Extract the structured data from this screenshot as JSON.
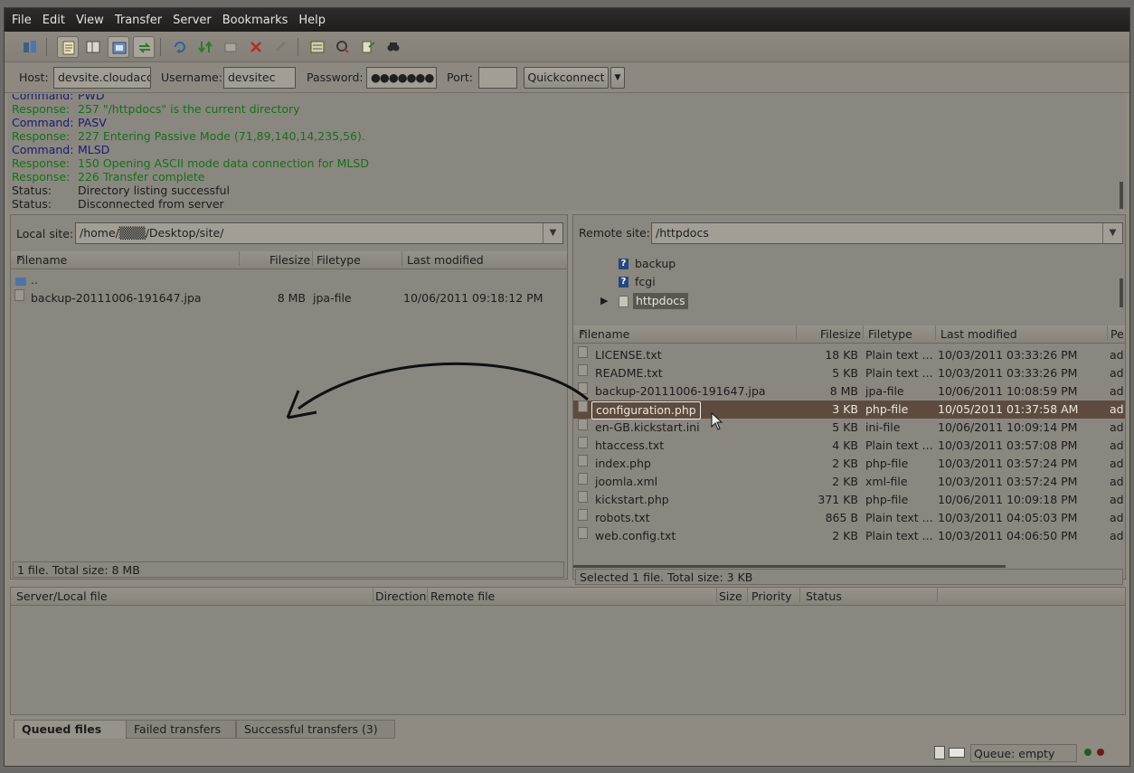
{
  "menu": [
    "File",
    "Edit",
    "View",
    "Transfer",
    "Server",
    "Bookmarks",
    "Help"
  ],
  "toolbar_icons": [
    "site-manager-icon",
    "toggle-log-icon",
    "toggle-local-tree-icon",
    "toggle-remote-tree-icon",
    "toggle-queue-icon",
    "refresh-icon",
    "process-queue-icon",
    "cancel-icon",
    "disconnect-icon",
    "reconnect-icon",
    "dir-compare-icon",
    "filter-icon",
    "sync-browse-icon",
    "search-icon"
  ],
  "quickconnect": {
    "host_label": "Host:",
    "host_value": "devsite.cloudacc",
    "username_label": "Username:",
    "username_value": "devsitec",
    "password_label": "Password:",
    "password_value": "●●●●●●●",
    "port_label": "Port:",
    "port_value": "",
    "button_label": "Quickconnect"
  },
  "log": [
    {
      "kind": "Command:",
      "text": "PWD",
      "type": "command"
    },
    {
      "kind": "Response:",
      "text": "257 \"/httpdocs\" is the current directory",
      "type": "response"
    },
    {
      "kind": "Command:",
      "text": "PASV",
      "type": "command"
    },
    {
      "kind": "Response:",
      "text": "227 Entering Passive Mode (71,89,140,14,235,56).",
      "type": "response"
    },
    {
      "kind": "Command:",
      "text": "MLSD",
      "type": "command"
    },
    {
      "kind": "Response:",
      "text": "150 Opening ASCII mode data connection for MLSD",
      "type": "response"
    },
    {
      "kind": "Response:",
      "text": "226 Transfer complete",
      "type": "response"
    },
    {
      "kind": "Status:",
      "text": "Directory listing successful",
      "type": "status"
    },
    {
      "kind": "Status:",
      "text": "Disconnected from server",
      "type": "status"
    }
  ],
  "local": {
    "label": "Local site:",
    "path": "/home/▒▒▒/Desktop/site/",
    "columns": [
      "Filename",
      "Filesize",
      "Filetype",
      "Last modified"
    ],
    "parent": "..",
    "files": [
      {
        "name": "backup-20111006-191647.jpa",
        "size": "8 MB",
        "type": "jpa-file",
        "modified": "10/06/2011 09:18:12 PM"
      }
    ],
    "status": "1 file. Total size: 8 MB"
  },
  "remote": {
    "label": "Remote site:",
    "path": "/httpdocs",
    "tree": [
      "backup",
      "fcgi",
      "httpdocs"
    ],
    "columns": [
      "Filename",
      "Filesize",
      "Filetype",
      "Last modified",
      "Pe"
    ],
    "files": [
      {
        "name": "LICENSE.txt",
        "size": "18 KB",
        "type": "Plain text ...",
        "modified": "10/03/2011 03:33:26 PM",
        "perm": "ad"
      },
      {
        "name": "README.txt",
        "size": "5 KB",
        "type": "Plain text ...",
        "modified": "10/03/2011 03:33:26 PM",
        "perm": "ad"
      },
      {
        "name": "backup-20111006-191647.jpa",
        "size": "8 MB",
        "type": "jpa-file",
        "modified": "10/06/2011 10:08:59 PM",
        "perm": "ad"
      },
      {
        "name": "configuration.php",
        "size": "3 KB",
        "type": "php-file",
        "modified": "10/05/2011 01:37:58 AM",
        "perm": "ad"
      },
      {
        "name": "en-GB.kickstart.ini",
        "size": "5 KB",
        "type": "ini-file",
        "modified": "10/06/2011 10:09:14 PM",
        "perm": "ad"
      },
      {
        "name": "htaccess.txt",
        "size": "4 KB",
        "type": "Plain text ...",
        "modified": "10/03/2011 03:57:08 PM",
        "perm": "ad"
      },
      {
        "name": "index.php",
        "size": "2 KB",
        "type": "php-file",
        "modified": "10/03/2011 03:57:24 PM",
        "perm": "ad"
      },
      {
        "name": "joomla.xml",
        "size": "2 KB",
        "type": "xml-file",
        "modified": "10/03/2011 03:57:24 PM",
        "perm": "ad"
      },
      {
        "name": "kickstart.php",
        "size": "371 KB",
        "type": "php-file",
        "modified": "10/06/2011 10:09:18 PM",
        "perm": "ad"
      },
      {
        "name": "robots.txt",
        "size": "865 B",
        "type": "Plain text ...",
        "modified": "10/03/2011 04:05:03 PM",
        "perm": "ad"
      },
      {
        "name": "web.config.txt",
        "size": "2 KB",
        "type": "Plain text ...",
        "modified": "10/03/2011 04:06:50 PM",
        "perm": "ad"
      }
    ],
    "selected_index": 3,
    "status": "Selected 1 file. Total size: 3 KB"
  },
  "queue": {
    "columns": [
      "Server/Local file",
      "Direction",
      "Remote file",
      "Size",
      "Priority",
      "Status"
    ],
    "tabs": [
      "Queued files",
      "Failed transfers",
      "Successful transfers (3)"
    ],
    "status": "Queue: empty"
  },
  "colors": {
    "selected_row": "#5e4b3f",
    "command": "#1b1a72",
    "response": "#15701a"
  }
}
